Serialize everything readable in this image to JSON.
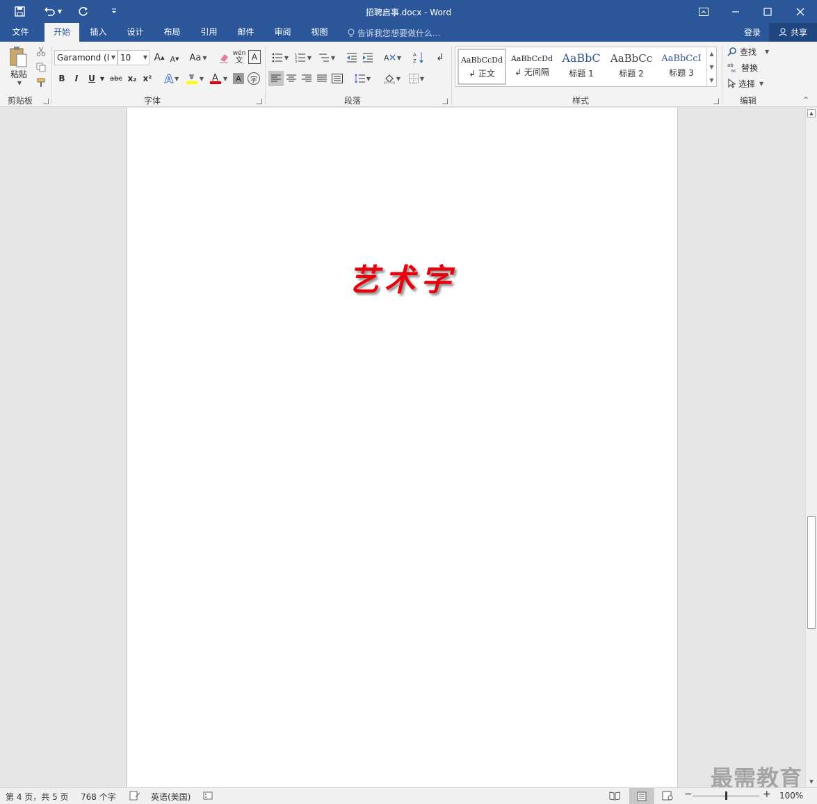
{
  "window": {
    "title": "招聘启事.docx - Word",
    "quick_access": {
      "save_icon": "save-icon",
      "undo_icon": "undo-icon",
      "redo_icon": "redo-icon",
      "customize_icon": "chevron-down-icon"
    },
    "controls": [
      "ribbon-display-icon",
      "minimize-icon",
      "maximize-icon",
      "close-icon"
    ]
  },
  "tabs": [
    {
      "label": "文件"
    },
    {
      "label": "开始"
    },
    {
      "label": "插入"
    },
    {
      "label": "设计"
    },
    {
      "label": "布局"
    },
    {
      "label": "引用"
    },
    {
      "label": "邮件"
    },
    {
      "label": "审阅"
    },
    {
      "label": "视图"
    }
  ],
  "active_tab": "开始",
  "tell_me": "告诉我您想要做什么...",
  "account": {
    "login": "登录",
    "share": "共享"
  },
  "ribbon": {
    "clipboard": {
      "label": "剪贴板",
      "paste": "粘贴"
    },
    "font": {
      "label": "字体",
      "font_name": "Garamond (I",
      "font_size": "10",
      "grow": "A",
      "shrink": "A",
      "change_case": "Aa",
      "phonetic": "wén",
      "bold": "B",
      "italic": "I",
      "underline": "U",
      "strike": "abc",
      "sub": "x₂",
      "sup": "x²"
    },
    "paragraph": {
      "label": "段落"
    },
    "styles": {
      "label": "样式",
      "items": [
        {
          "preview": "AaBbCcDd",
          "name": "↲ 正文"
        },
        {
          "preview": "AaBbCcDd",
          "name": "↲ 无间隔"
        },
        {
          "preview": "AaBbC",
          "name": "标题 1"
        },
        {
          "preview": "AaBbCc",
          "name": "标题 2"
        },
        {
          "preview": "AaBbCcI",
          "name": "标题 3"
        }
      ]
    },
    "editing": {
      "label": "编辑",
      "find": "查找",
      "replace": "替换",
      "select": "选择"
    }
  },
  "document": {
    "wordart": "艺术字"
  },
  "status": {
    "page": "第 4 页，共 5 页",
    "words": "768 个字",
    "language": "英语(美国)",
    "zoom": "100%"
  },
  "watermark": "最需教育",
  "colors": {
    "brand": "#2b579a",
    "wordart": "#e8000b",
    "highlight": "#ffff00",
    "font_color": "#e8000b"
  }
}
